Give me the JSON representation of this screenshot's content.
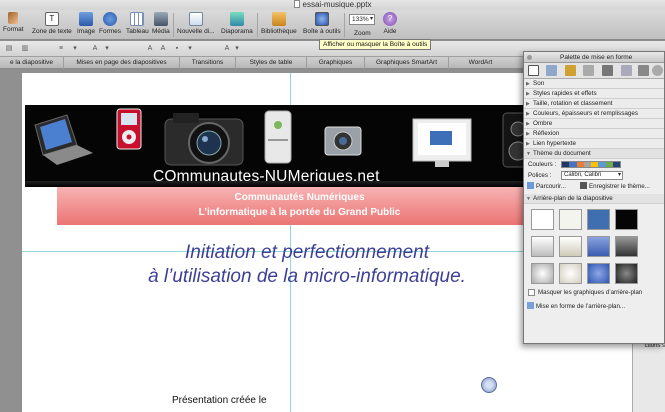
{
  "window": {
    "title": "essai-musique.pptx"
  },
  "toolbar": {
    "items": [
      {
        "label": "Format",
        "icon": "format-brush-icon"
      },
      {
        "label": "Zone de texte",
        "icon": "text-box-icon"
      },
      {
        "label": "Image",
        "icon": "image-icon"
      },
      {
        "label": "Formes",
        "icon": "shapes-icon"
      },
      {
        "label": "Tableau",
        "icon": "table-icon"
      },
      {
        "label": "Média",
        "icon": "media-icon"
      },
      {
        "label": "Nouvelle di...",
        "icon": "new-slide-icon"
      },
      {
        "label": "Diaporama",
        "icon": "slideshow-icon"
      },
      {
        "label": "Bibliothèque",
        "icon": "library-icon"
      },
      {
        "label": "Boîte à outils",
        "icon": "toolbox-icon"
      },
      {
        "label": "Zoom",
        "icon": "zoom-icon"
      },
      {
        "label": "Aide",
        "icon": "help-icon"
      }
    ],
    "zoom_value": "133%"
  },
  "tooltip": {
    "text": "Afficher ou masquer la Boîte à outils"
  },
  "tabs": [
    "e la diapositive",
    "Mises en page des diapositives",
    "Transitions",
    "Styles de table",
    "Graphiques",
    "Graphiques SmartArt",
    "WordArt"
  ],
  "slide": {
    "banner_text": "COmmunautes-NUMeriques.net",
    "band_line1": "Communautés Numériques",
    "band_line2": "L’informatique à la portée du Grand Public",
    "title_line1": "Initiation et perfectionnement",
    "title_line2": "à l’utilisation de la micro-informatique.",
    "subtitle": "Présentation créée le"
  },
  "right_strip": {
    "text": "ctions s"
  },
  "palette": {
    "title": "Palette de mise en forme",
    "sections": [
      "Son",
      "Styles rapides et effets",
      "Taille, rotation et classement",
      "Couleurs, épaisseurs et remplissages",
      "Ombre",
      "Réflexion",
      "Lien hypertexte"
    ],
    "theme_section": "Thème du document",
    "colors_label": "Couleurs :",
    "fonts_label": "Polices :",
    "fonts_value": "Calibri, Calibri",
    "browse_button": "Parcourir...",
    "save_theme_button": "Enregistrer le thème...",
    "background_section": "Arrière-plan de la diapositive",
    "hide_bg_label": "Masquer les graphiques d’arrière-plan",
    "format_bg_button": "Mise en forme de l’arrière-plan...",
    "theme_colors": [
      "#1f3864",
      "#4472c4",
      "#ed7d31",
      "#a5a5a5",
      "#ffc000",
      "#5b9bd5",
      "#70ad47",
      "#264478"
    ],
    "bg_swatches": [
      "#ffffff",
      "#f4f4ee",
      "#3f6fb0",
      "#050505",
      "#e4e4e4",
      "#e8e6dc",
      "#5a78c0",
      "#5a5a5a",
      "#dcdcdc",
      "#ecebe3",
      "#3f64b6",
      "#4a4a4a"
    ]
  }
}
